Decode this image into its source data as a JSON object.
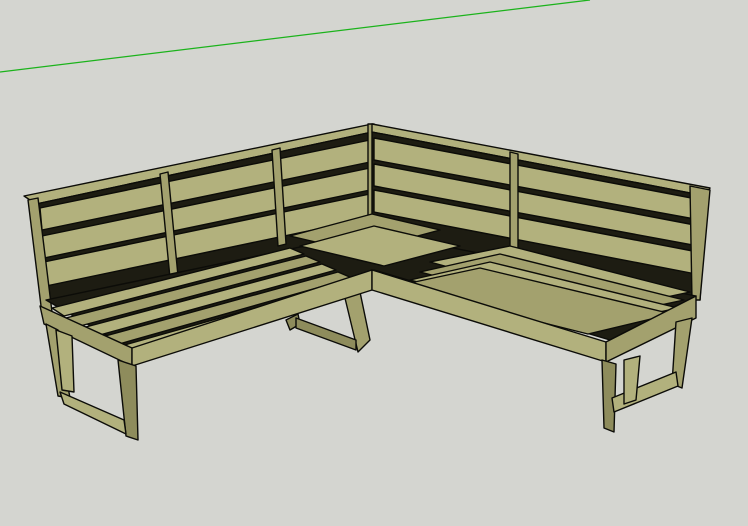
{
  "viewport": {
    "background_color": "#d4d5d0",
    "green_axis_color": "#1bb31b"
  },
  "model": {
    "material": {
      "face_light": "#b2b17d",
      "face_mid": "#a3a16e",
      "face_dark": "#8e8c5c",
      "gap_color": "#1d1c12",
      "edge_color": "#0c0c08"
    }
  }
}
